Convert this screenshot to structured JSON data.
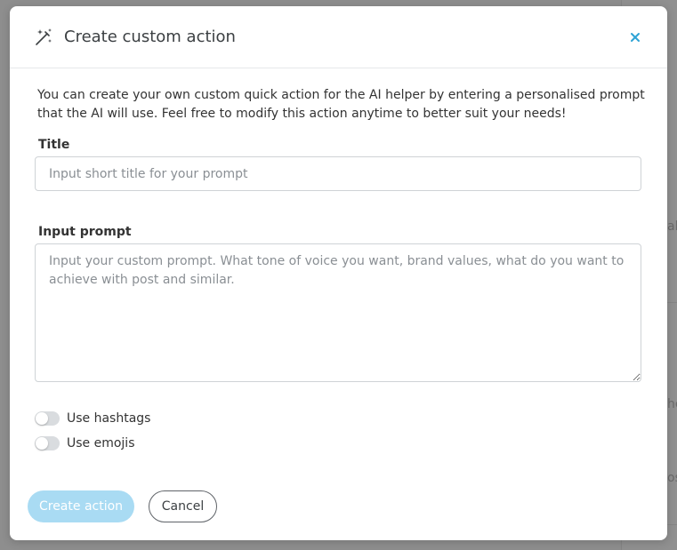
{
  "modal": {
    "title": "Create custom action",
    "description": "You can create your own custom quick action for the AI helper by entering a personalised prompt that the AI will use. Feel free to modify this action anytime to better suit your needs!",
    "title_field": {
      "label": "Title",
      "value": "",
      "placeholder": "Input short title for your prompt"
    },
    "prompt_field": {
      "label": "Input prompt",
      "value": "",
      "placeholder": "Input your custom prompt. What tone of voice you want, brand values, what do you want to achieve with post and similar."
    },
    "toggles": [
      {
        "label": "Use hashtags",
        "checked": false
      },
      {
        "label": "Use emojis",
        "checked": false
      }
    ],
    "buttons": {
      "create_label": "Create action",
      "cancel_label": "Cancel"
    }
  },
  "background_fragments": [
    "al",
    "he",
    "os"
  ],
  "icons": {
    "header": "magic-wand-icon",
    "close": "close-icon"
  },
  "colors": {
    "accent": "#2ea3d5",
    "primary_button_disabled": "#a9dbf3",
    "overlay": "#8e8e8e",
    "toggle_off": "#d9dcdf"
  }
}
